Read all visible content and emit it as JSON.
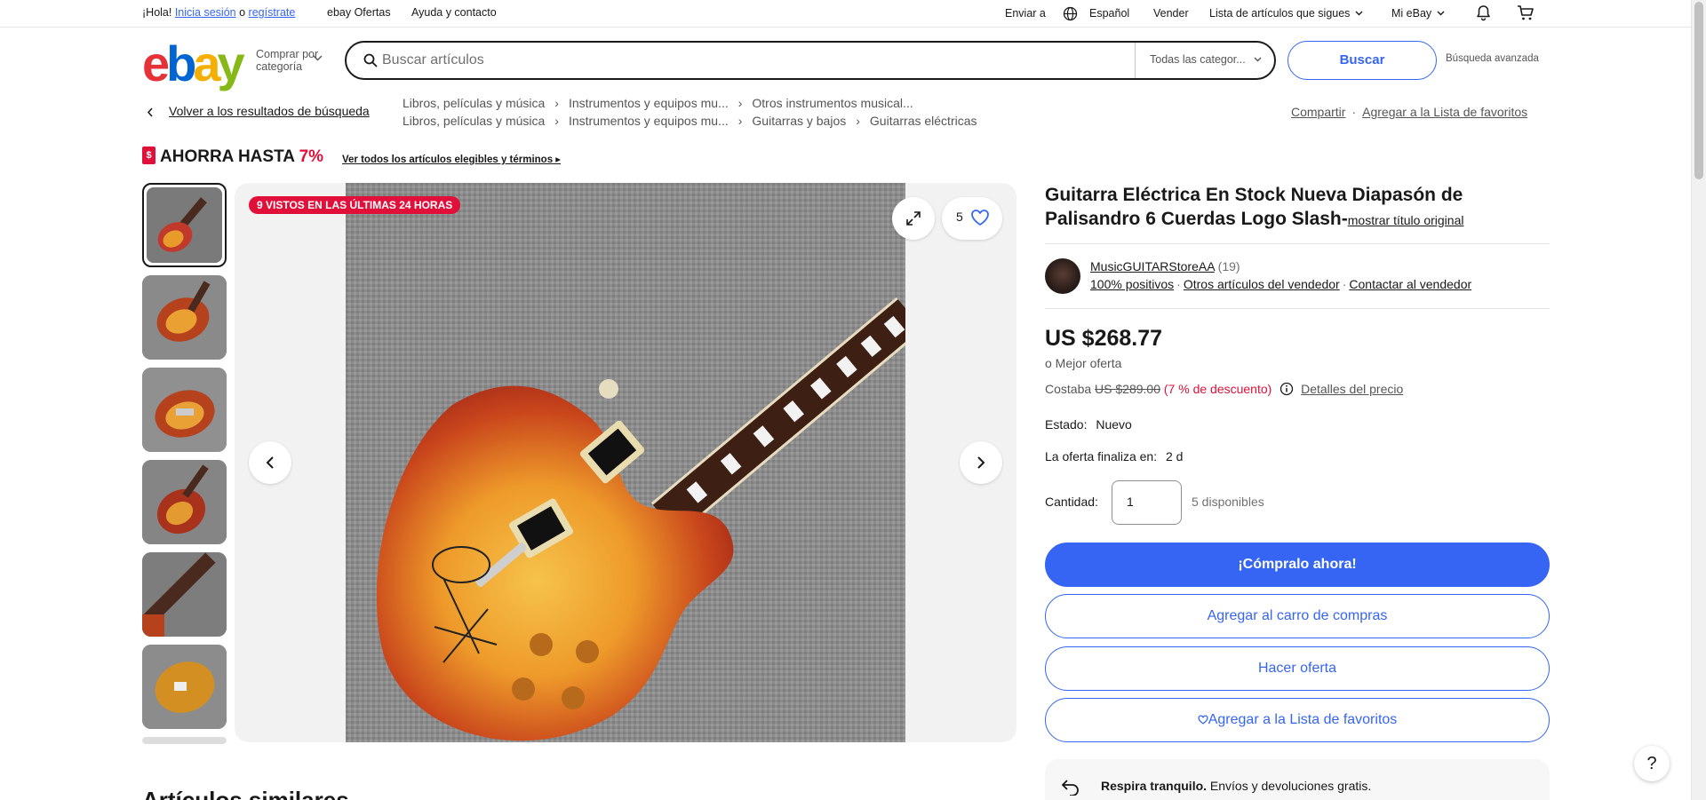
{
  "topbar": {
    "greeting": "¡Hola!",
    "sign_in": "Inicia sesión",
    "or": "o",
    "register": "regístrate",
    "deals": "ebay Ofertas",
    "help": "Ayuda y contacto",
    "ship_to": "Enviar a",
    "language": "Español",
    "sell": "Vender",
    "watchlist": "Lista de artículos que sigues",
    "my_ebay": "Mi eBay"
  },
  "header": {
    "logo": [
      "e",
      "b",
      "a",
      "y"
    ],
    "shop_by_category": "Comprar por categoría",
    "search_placeholder": "Buscar artículos",
    "category_select": "Todas las categor...",
    "search_button": "Buscar",
    "advanced_search": "Búsqueda avanzada"
  },
  "breadcrumbs": {
    "back": "Volver a los resultados de búsqueda",
    "line1": [
      "Libros, películas y música",
      "Instrumentos y equipos mu...",
      "Otros instrumentos musical..."
    ],
    "line2": [
      "Libros, películas y música",
      "Instrumentos y equipos mu...",
      "Guitarras y bajos",
      "Guitarras eléctricas"
    ],
    "share": "Compartir",
    "add_watchlist": "Agregar a la Lista de favoritos"
  },
  "promo": {
    "badge": "$",
    "text": "AHORRA HASTA",
    "percent": "7%",
    "link": "Ver todos los artículos elegibles y términos"
  },
  "gallery": {
    "views_badge": "9 VISTOS EN LAS ÚLTIMAS 24 HORAS",
    "watchers": "5",
    "thumb_count": 6
  },
  "item": {
    "title": "Guitarra Eléctrica En Stock Nueva Diapasón de Palisandro 6 Cuerdas Logo Slash-",
    "show_original": "mostrar título original",
    "seller": {
      "name": "MusicGUITARStoreAA",
      "feedback_count": "(19)",
      "positive": "100% positivos",
      "other_items": "Otros artículos del vendedor",
      "contact": "Contactar al vendedor"
    },
    "price": "US $268.77",
    "best_offer": "o Mejor oferta",
    "was_label": "Costaba",
    "was_price": "US $289.00",
    "discount": "(7 % de descuento)",
    "price_details": "Detalles del precio",
    "condition_label": "Estado:",
    "condition_value": "Nuevo",
    "ends_label": "La oferta finaliza en:",
    "ends_value": "2 d",
    "quantity_label": "Cantidad:",
    "quantity_value": "1",
    "available": "5 disponibles",
    "buy_now": "¡Cómpralo ahora!",
    "add_to_cart": "Agregar al carro de compras",
    "make_offer": "Hacer oferta",
    "add_watchlist": "Agregar a la Lista de favoritos",
    "returns_bold": "Respira tranquilo.",
    "returns_text": "Envíos y devoluciones gratis."
  },
  "similar_heading": "Artículos similares",
  "help": "?",
  "colors": {
    "primary": "#3665f3",
    "sale_red": "#e0103a",
    "text": "#191919"
  }
}
